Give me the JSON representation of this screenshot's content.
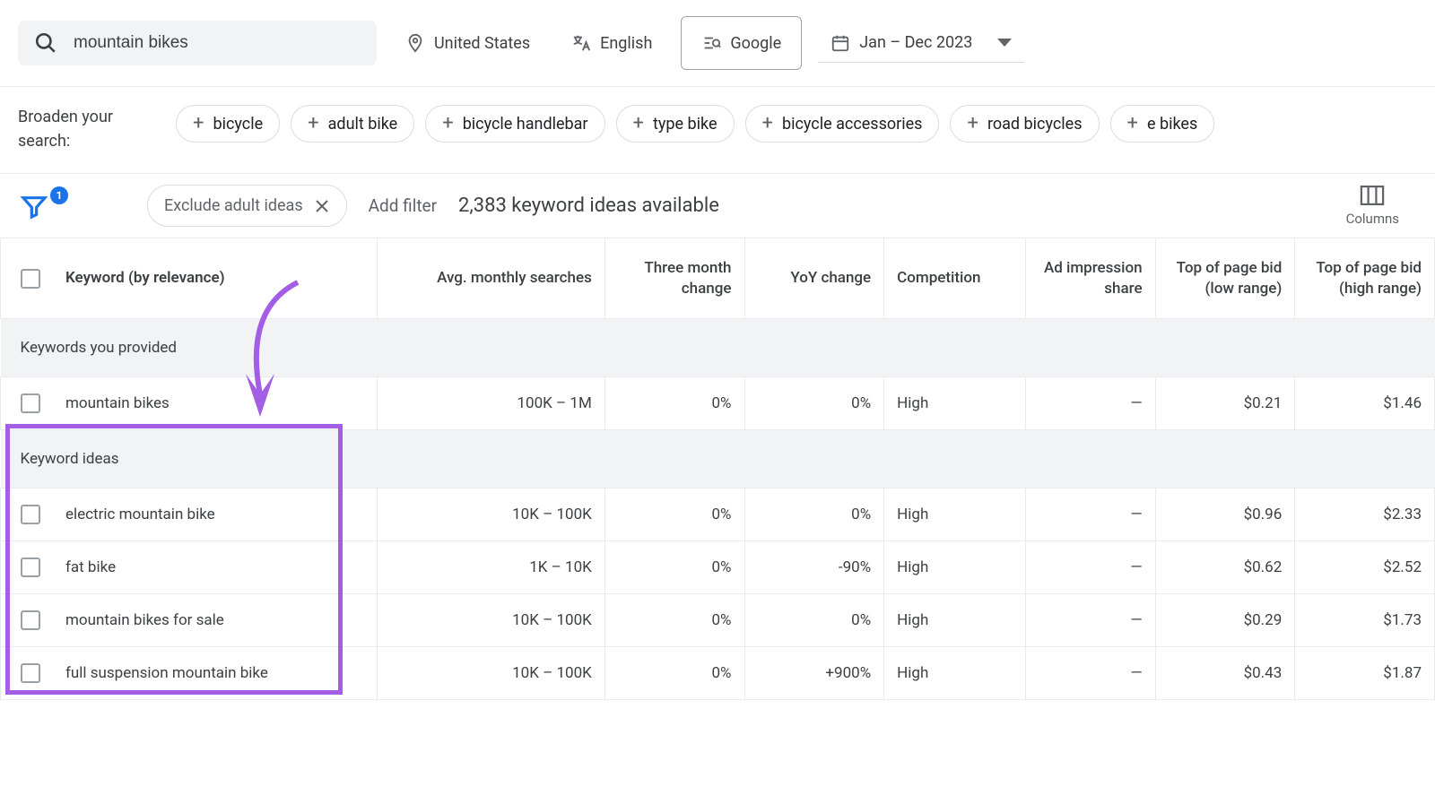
{
  "search": {
    "value": "mountain bikes"
  },
  "filters_top": {
    "location": "United States",
    "language": "English",
    "network": "Google",
    "date_range": "Jan – Dec 2023"
  },
  "broaden": {
    "label": "Broaden your search:",
    "chips": [
      "bicycle",
      "adult bike",
      "bicycle handlebar",
      "type bike",
      "bicycle accessories",
      "road bicycles",
      "e bikes"
    ]
  },
  "filter_bar": {
    "badge": "1",
    "applied": "Exclude adult ideas",
    "add_filter": "Add filter",
    "ideas_count": "2,383 keyword ideas available",
    "columns": "Columns"
  },
  "table": {
    "headers": {
      "keyword": "Keyword (by relevance)",
      "avg": "Avg. monthly searches",
      "three_month": "Three month change",
      "yoy": "YoY change",
      "competition": "Competition",
      "impression": "Ad impression share",
      "bid_low": "Top of page bid (low range)",
      "bid_high": "Top of page bid (high range)"
    },
    "section_provided": "Keywords you provided",
    "section_ideas": "Keyword ideas",
    "rows_provided": [
      {
        "keyword": "mountain bikes",
        "avg": "100K – 1M",
        "three_month": "0%",
        "yoy": "0%",
        "comp": "High",
        "imp": "—",
        "low": "$0.21",
        "high": "$1.46"
      }
    ],
    "rows_ideas": [
      {
        "keyword": "electric mountain bike",
        "avg": "10K – 100K",
        "three_month": "0%",
        "yoy": "0%",
        "comp": "High",
        "imp": "—",
        "low": "$0.96",
        "high": "$2.33"
      },
      {
        "keyword": "fat bike",
        "avg": "1K – 10K",
        "three_month": "0%",
        "yoy": "-90%",
        "comp": "High",
        "imp": "—",
        "low": "$0.62",
        "high": "$2.52"
      },
      {
        "keyword": "mountain bikes for sale",
        "avg": "10K – 100K",
        "three_month": "0%",
        "yoy": "0%",
        "comp": "High",
        "imp": "—",
        "low": "$0.29",
        "high": "$1.73"
      },
      {
        "keyword": "full suspension mountain bike",
        "avg": "10K – 100K",
        "three_month": "0%",
        "yoy": "+900%",
        "comp": "High",
        "imp": "—",
        "low": "$0.43",
        "high": "$1.87"
      }
    ]
  },
  "annotation": {
    "highlight_color": "#a45ee5"
  }
}
